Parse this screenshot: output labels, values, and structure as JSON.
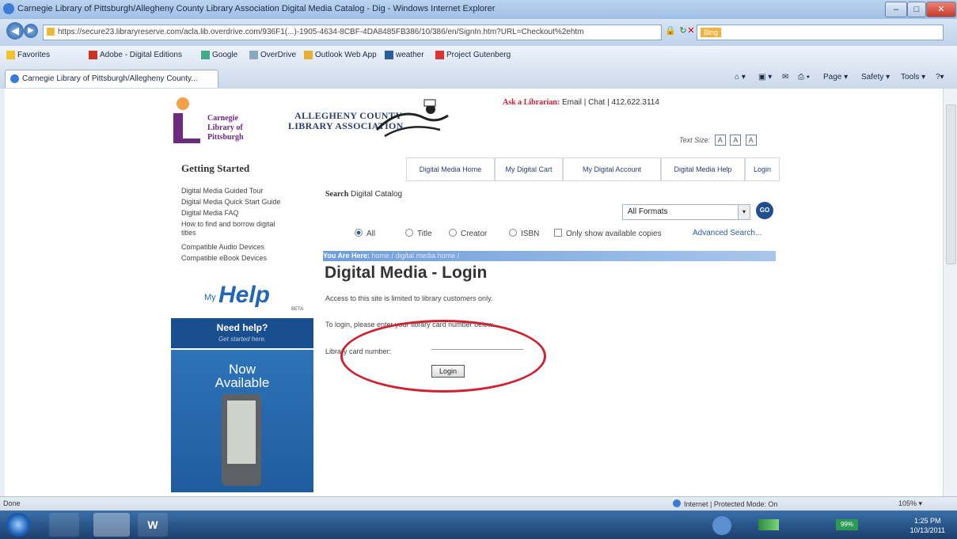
{
  "window": {
    "title": "Carnegie Library of Pittsburgh/Allegheny County Library Association Digital Media Catalog - Dig - Windows Internet Explorer",
    "minimize": "–",
    "maximize": "□",
    "close": "✕"
  },
  "address_bar": {
    "url": "https://secure23.libraryreserve.com/acla.lib.overdrive.com/936F1(...)-1905-4634-8CBF-4DA8485FB386/10/386/en/SignIn.htm?URL=Checkout%2ehtm",
    "search_placeholder": "Bing"
  },
  "favorites": {
    "label": "Favorites",
    "items": [
      "Adobe - Digital Editions",
      "Google",
      "OverDrive",
      "Outlook Web App",
      "weather",
      "Project Gutenberg"
    ]
  },
  "tab": {
    "title": "Carnegie Library of Pittsburgh/Allegheny County..."
  },
  "commandbar": {
    "page": "Page ▾",
    "safety": "Safety ▾",
    "tools": "Tools ▾",
    "help": "?▾"
  },
  "logos": {
    "clp_line1": "Carnegie",
    "clp_line2": "Library of",
    "clp_line3": "Pittsburgh",
    "acla_line1": "ALLEGHENY COUNTY",
    "acla_line2": "LIBRARY ASSOCIATION"
  },
  "ask": {
    "label": "Ask a Librarian:",
    "contacts": "Email | Chat | 412.622.3114"
  },
  "text_size": {
    "label": "Text Size:",
    "btn": "A"
  },
  "left_nav": {
    "heading": "Getting Started",
    "links": [
      "Digital Media Guided Tour",
      "Digital Media Quick Start Guide",
      "Digital Media FAQ",
      "How to find and borrow digital",
      "titles",
      "Compatible Audio Devices",
      "Compatible eBook Devices"
    ]
  },
  "myhelp": {
    "my": "My",
    "help": "Help",
    "beta": "BETA"
  },
  "needhelp": {
    "title": "Need help?",
    "sub": "Get started here."
  },
  "now_available": {
    "line1": "Now",
    "line2": "Available"
  },
  "nav_tabs": [
    "Digital Media Home",
    "My Digital Cart",
    "My Digital Account",
    "Digital Media Help",
    "Login"
  ],
  "search": {
    "label_bold": "Search",
    "label_rest": " Digital Catalog",
    "format": "All Formats",
    "go": "GO",
    "options": [
      "All",
      "Title",
      "Creator",
      "ISBN"
    ],
    "available_only": "Only show available copies",
    "advanced": "Advanced Search..."
  },
  "breadcrumb": {
    "prefix": "You Are Here:",
    "path": "home / digital media home /"
  },
  "login": {
    "title": "Digital Media - Login",
    "access": "Access to this site is limited to library customers only.",
    "instructions": "To login, please enter your library card number below.",
    "card_label": "Library card number:",
    "button": "Login"
  },
  "status_bar": {
    "left": "Done",
    "zone": "Internet | Protected Mode: On",
    "zoom": "105% ▾"
  },
  "taskbar": {
    "time": "1:25 PM",
    "date": "10/13/2011",
    "battery": "99%"
  },
  "colors": {
    "accent": "#2a5d9c",
    "circle": "#cc2333",
    "clp_purple": "#6e2a7f"
  }
}
